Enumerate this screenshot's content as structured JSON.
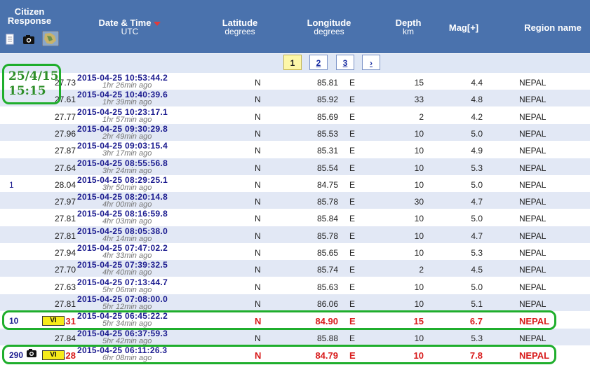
{
  "header": {
    "citizen_response": "Citizen Response",
    "date_time": "Date & Time",
    "date_time_sub": "UTC",
    "latitude": "Latitude",
    "latitude_sub": "degrees",
    "longitude": "Longitude",
    "longitude_sub": "degrees",
    "depth": "Depth",
    "depth_sub": "km",
    "mag": "Mag[+]",
    "region": "Region name"
  },
  "pager": {
    "pages": [
      "1",
      "2",
      "3"
    ],
    "next": "›",
    "current": "1"
  },
  "annotation_note": "25/4/15 15:15",
  "colors": {
    "header_bg": "#4a72ad",
    "alt_row": "#e2e8f5",
    "highlight": "#d81b1b",
    "annotation": "#1fae2c"
  },
  "rows": [
    {
      "dt": "2015-04-25   10:53:44.2",
      "ago": "1hr 26min ago",
      "lat": "27.73",
      "ns": "N",
      "lon": "85.81",
      "ew": "E",
      "depth": "15",
      "mag": "4.4",
      "region": "NEPAL",
      "cr": "",
      "vi": ""
    },
    {
      "dt": "2015-04-25   10:40:39.6",
      "ago": "1hr 39min ago",
      "lat": "27.61",
      "ns": "N",
      "lon": "85.92",
      "ew": "E",
      "depth": "33",
      "mag": "4.8",
      "region": "NEPAL",
      "cr": "",
      "vi": ""
    },
    {
      "dt": "2015-04-25   10:23:17.1",
      "ago": "1hr 57min ago",
      "lat": "27.77",
      "ns": "N",
      "lon": "85.69",
      "ew": "E",
      "depth": "2",
      "mag": "4.2",
      "region": "NEPAL",
      "cr": "",
      "vi": ""
    },
    {
      "dt": "2015-04-25   09:30:29.8",
      "ago": "2hr 49min ago",
      "lat": "27.96",
      "ns": "N",
      "lon": "85.53",
      "ew": "E",
      "depth": "10",
      "mag": "5.0",
      "region": "NEPAL",
      "cr": "",
      "vi": ""
    },
    {
      "dt": "2015-04-25   09:03:15.4",
      "ago": "3hr 17min ago",
      "lat": "27.87",
      "ns": "N",
      "lon": "85.31",
      "ew": "E",
      "depth": "10",
      "mag": "4.9",
      "region": "NEPAL",
      "cr": "",
      "vi": ""
    },
    {
      "dt": "2015-04-25   08:55:56.8",
      "ago": "3hr 24min ago",
      "lat": "27.64",
      "ns": "N",
      "lon": "85.54",
      "ew": "E",
      "depth": "10",
      "mag": "5.3",
      "region": "NEPAL",
      "cr": "",
      "vi": ""
    },
    {
      "dt": "2015-04-25   08:29:25.1",
      "ago": "3hr 50min ago",
      "lat": "28.04",
      "ns": "N",
      "lon": "84.75",
      "ew": "E",
      "depth": "10",
      "mag": "5.0",
      "region": "NEPAL",
      "cr": "1",
      "vi": ""
    },
    {
      "dt": "2015-04-25   08:20:14.8",
      "ago": "4hr 00min ago",
      "lat": "27.97",
      "ns": "N",
      "lon": "85.78",
      "ew": "E",
      "depth": "30",
      "mag": "4.7",
      "region": "NEPAL",
      "cr": "",
      "vi": ""
    },
    {
      "dt": "2015-04-25   08:16:59.8",
      "ago": "4hr 03min ago",
      "lat": "27.81",
      "ns": "N",
      "lon": "85.84",
      "ew": "E",
      "depth": "10",
      "mag": "5.0",
      "region": "NEPAL",
      "cr": "",
      "vi": ""
    },
    {
      "dt": "2015-04-25   08:05:38.0",
      "ago": "4hr 14min ago",
      "lat": "27.81",
      "ns": "N",
      "lon": "85.78",
      "ew": "E",
      "depth": "10",
      "mag": "4.7",
      "region": "NEPAL",
      "cr": "",
      "vi": ""
    },
    {
      "dt": "2015-04-25   07:47:02.2",
      "ago": "4hr 33min ago",
      "lat": "27.94",
      "ns": "N",
      "lon": "85.65",
      "ew": "E",
      "depth": "10",
      "mag": "5.3",
      "region": "NEPAL",
      "cr": "",
      "vi": ""
    },
    {
      "dt": "2015-04-25   07:39:32.5",
      "ago": "4hr 40min ago",
      "lat": "27.70",
      "ns": "N",
      "lon": "85.74",
      "ew": "E",
      "depth": "2",
      "mag": "4.5",
      "region": "NEPAL",
      "cr": "",
      "vi": ""
    },
    {
      "dt": "2015-04-25   07:13:44.7",
      "ago": "5hr 06min ago",
      "lat": "27.63",
      "ns": "N",
      "lon": "85.63",
      "ew": "E",
      "depth": "10",
      "mag": "5.0",
      "region": "NEPAL",
      "cr": "",
      "vi": ""
    },
    {
      "dt": "2015-04-25   07:08:00.0",
      "ago": "5hr 12min ago",
      "lat": "27.81",
      "ns": "N",
      "lon": "86.06",
      "ew": "E",
      "depth": "10",
      "mag": "5.1",
      "region": "NEPAL",
      "cr": "",
      "vi": ""
    },
    {
      "dt": "2015-04-25   06:45:22.2",
      "ago": "5hr 34min ago",
      "lat": "28.31",
      "ns": "N",
      "lon": "84.90",
      "ew": "E",
      "depth": "15",
      "mag": "6.7",
      "region": "NEPAL",
      "cr": "10",
      "vi": "VI"
    },
    {
      "dt": "2015-04-25   06:37:59.3",
      "ago": "5hr 42min ago",
      "lat": "27.84",
      "ns": "N",
      "lon": "85.88",
      "ew": "E",
      "depth": "10",
      "mag": "5.3",
      "region": "NEPAL",
      "cr": "",
      "vi": ""
    },
    {
      "dt": "2015-04-25   06:11:26.3",
      "ago": "6hr 08min ago",
      "lat": "28.28",
      "ns": "N",
      "lon": "84.79",
      "ew": "E",
      "depth": "10",
      "mag": "7.8",
      "region": "NEPAL",
      "cr": "290",
      "vi": "VI"
    }
  ]
}
